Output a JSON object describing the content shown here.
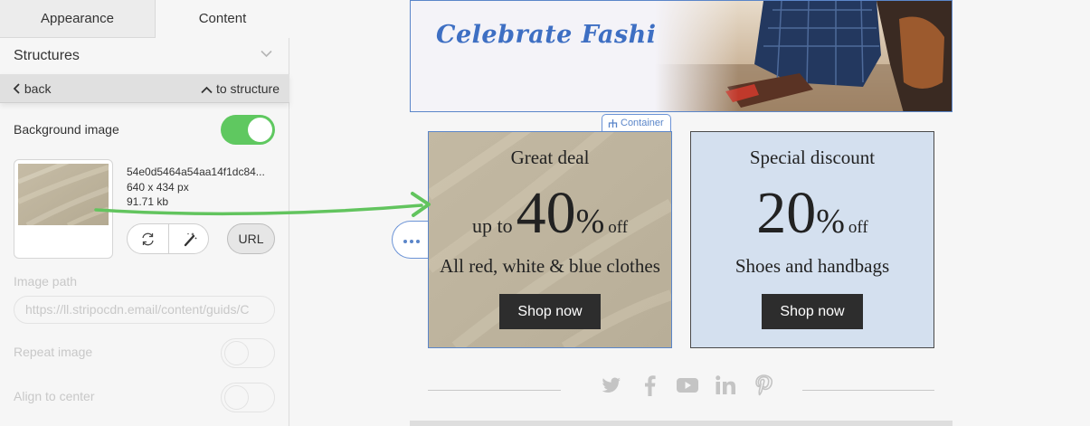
{
  "tabs": {
    "appearance": "Appearance",
    "content": "Content"
  },
  "section": {
    "title": "Structures"
  },
  "nav": {
    "back": "back",
    "to_structure": "to structure"
  },
  "background_image": {
    "label": "Background image",
    "enabled": true,
    "file_name": "54e0d5464a54aa14f1dc84...",
    "dimensions": "640 x 434 px",
    "size": "91.71 kb",
    "url_button": "URL"
  },
  "image_path": {
    "label": "Image path",
    "value": "https://ll.stripocdn.email/content/guids/C"
  },
  "repeat_image": {
    "label": "Repeat image",
    "enabled": false
  },
  "align_center": {
    "label": "Align to center",
    "enabled": false
  },
  "banner": {
    "title": "Celebrate Fashionably"
  },
  "container_tag": "Container",
  "card1": {
    "title": "Great deal",
    "prefix": "up to",
    "number": "40",
    "percent": "%",
    "suffix": "off",
    "subtitle": "All red, white & blue clothes",
    "button": "Shop now"
  },
  "card2": {
    "title": "Special discount",
    "number": "20",
    "percent": "%",
    "suffix": "off",
    "subtitle": "Shoes and handbags",
    "button": "Shop now"
  },
  "social_icons": [
    "twitter-icon",
    "facebook-icon",
    "youtube-icon",
    "linkedin-icon",
    "pinterest-icon"
  ],
  "colors": {
    "accent_green": "#5fc860",
    "selection_blue": "#5b86c9",
    "card2_bg": "#d4e0ef",
    "button_dark": "#2d2d2d"
  }
}
